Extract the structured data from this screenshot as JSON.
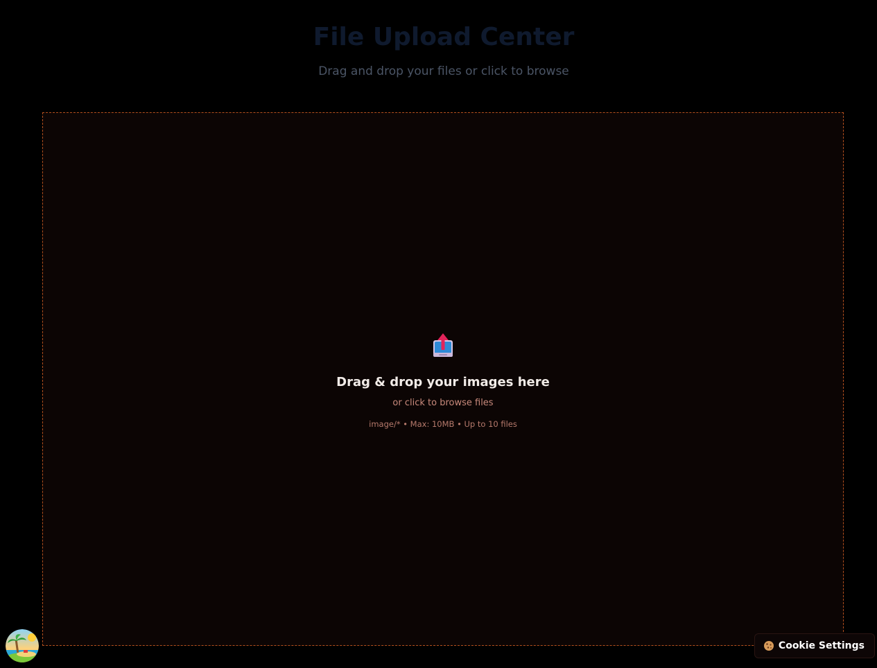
{
  "header": {
    "title": "File Upload Center",
    "subtitle": "Drag and drop your files or click to browse"
  },
  "dropzone": {
    "icon": "upload-tray-icon",
    "heading": "Drag & drop your images here",
    "subtext": "or click to browse files",
    "meta": "image/* • Max: 10MB • Up to 10 files"
  },
  "avatar": {
    "icon": "beach-island-icon"
  },
  "cookie": {
    "icon": "cookie-icon",
    "label": "Cookie Settings"
  },
  "colors": {
    "background": "#000000",
    "dropzone_bg": "#0c0504",
    "dropzone_border": "#b5501e",
    "title": "#0f1a2e",
    "subtitle": "#4b5566",
    "accent_text": "#c98a7c"
  }
}
